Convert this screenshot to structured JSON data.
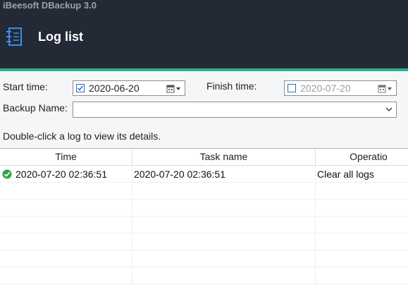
{
  "app": {
    "title": "iBeesoft DBackup 3.0"
  },
  "header": {
    "title": "Log list",
    "icon": "log-list-icon"
  },
  "filters": {
    "start_label": "Start time:",
    "start_checked": true,
    "start_value": "2020-06-20",
    "finish_label": "Finish time:",
    "finish_checked": false,
    "finish_value": "2020-07-20",
    "backup_name_label": "Backup Name:",
    "backup_name_value": ""
  },
  "hint": "Double-click a log to view its details.",
  "table": {
    "columns": [
      "Time",
      "Task name",
      "Operatio"
    ],
    "rows": [
      {
        "status_icon": "success-check-icon",
        "time": "2020-07-20 02:36:51",
        "task_name": "2020-07-20 02:36:51",
        "operation": "Clear all logs"
      }
    ]
  },
  "colors": {
    "header_bg": "#232a35",
    "accent": "#2ab38b",
    "success": "#2aa845"
  }
}
